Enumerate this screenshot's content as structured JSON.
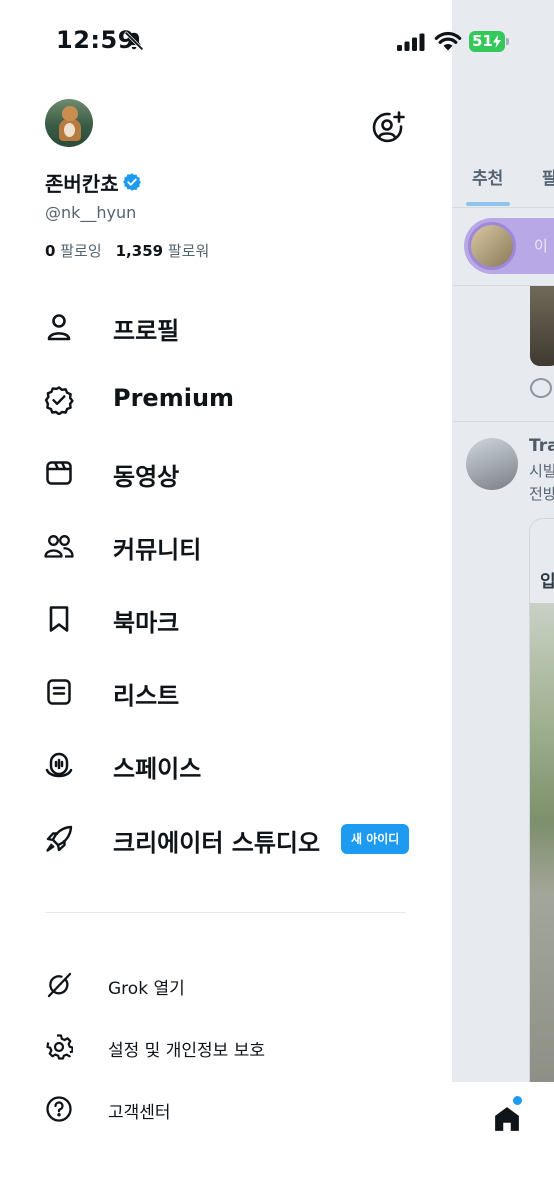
{
  "status_bar": {
    "time": "12:59",
    "battery": "51",
    "battery_color": "#34c759"
  },
  "profile": {
    "display_name": "존버칸쵸",
    "handle": "@nk__hyun",
    "following_count": "0",
    "following_label": "팔로잉",
    "followers_count": "1,359",
    "followers_label": "팔로워"
  },
  "menu": {
    "items": [
      {
        "label": "프로필",
        "icon": "person-icon"
      },
      {
        "label": "Premium",
        "icon": "premium-badge-icon"
      },
      {
        "label": "동영상",
        "icon": "video-icon"
      },
      {
        "label": "커뮤니티",
        "icon": "communities-icon"
      },
      {
        "label": "북마크",
        "icon": "bookmark-icon"
      },
      {
        "label": "리스트",
        "icon": "list-icon"
      },
      {
        "label": "스페이스",
        "icon": "spaces-icon"
      },
      {
        "label": "크리에이터 스튜디오",
        "icon": "rocket-icon",
        "badge": "새 아이디"
      }
    ]
  },
  "secondary": {
    "items": [
      {
        "label": "Grok 열기",
        "icon": "grok-icon"
      },
      {
        "label": "설정 및 개인정보 보호",
        "icon": "gear-icon"
      },
      {
        "label": "고객센터",
        "icon": "help-icon"
      }
    ]
  },
  "background_feed": {
    "tab_1": "추천",
    "tab_2": "팔",
    "live_text": "이 ",
    "tweet_name": "Tra",
    "tweet_line_1": "시빌",
    "tweet_line_2": "전방",
    "card_title": "입"
  },
  "colors": {
    "accent": "#1d9bf0",
    "text_primary": "#0f1419",
    "text_secondary": "#536471"
  }
}
